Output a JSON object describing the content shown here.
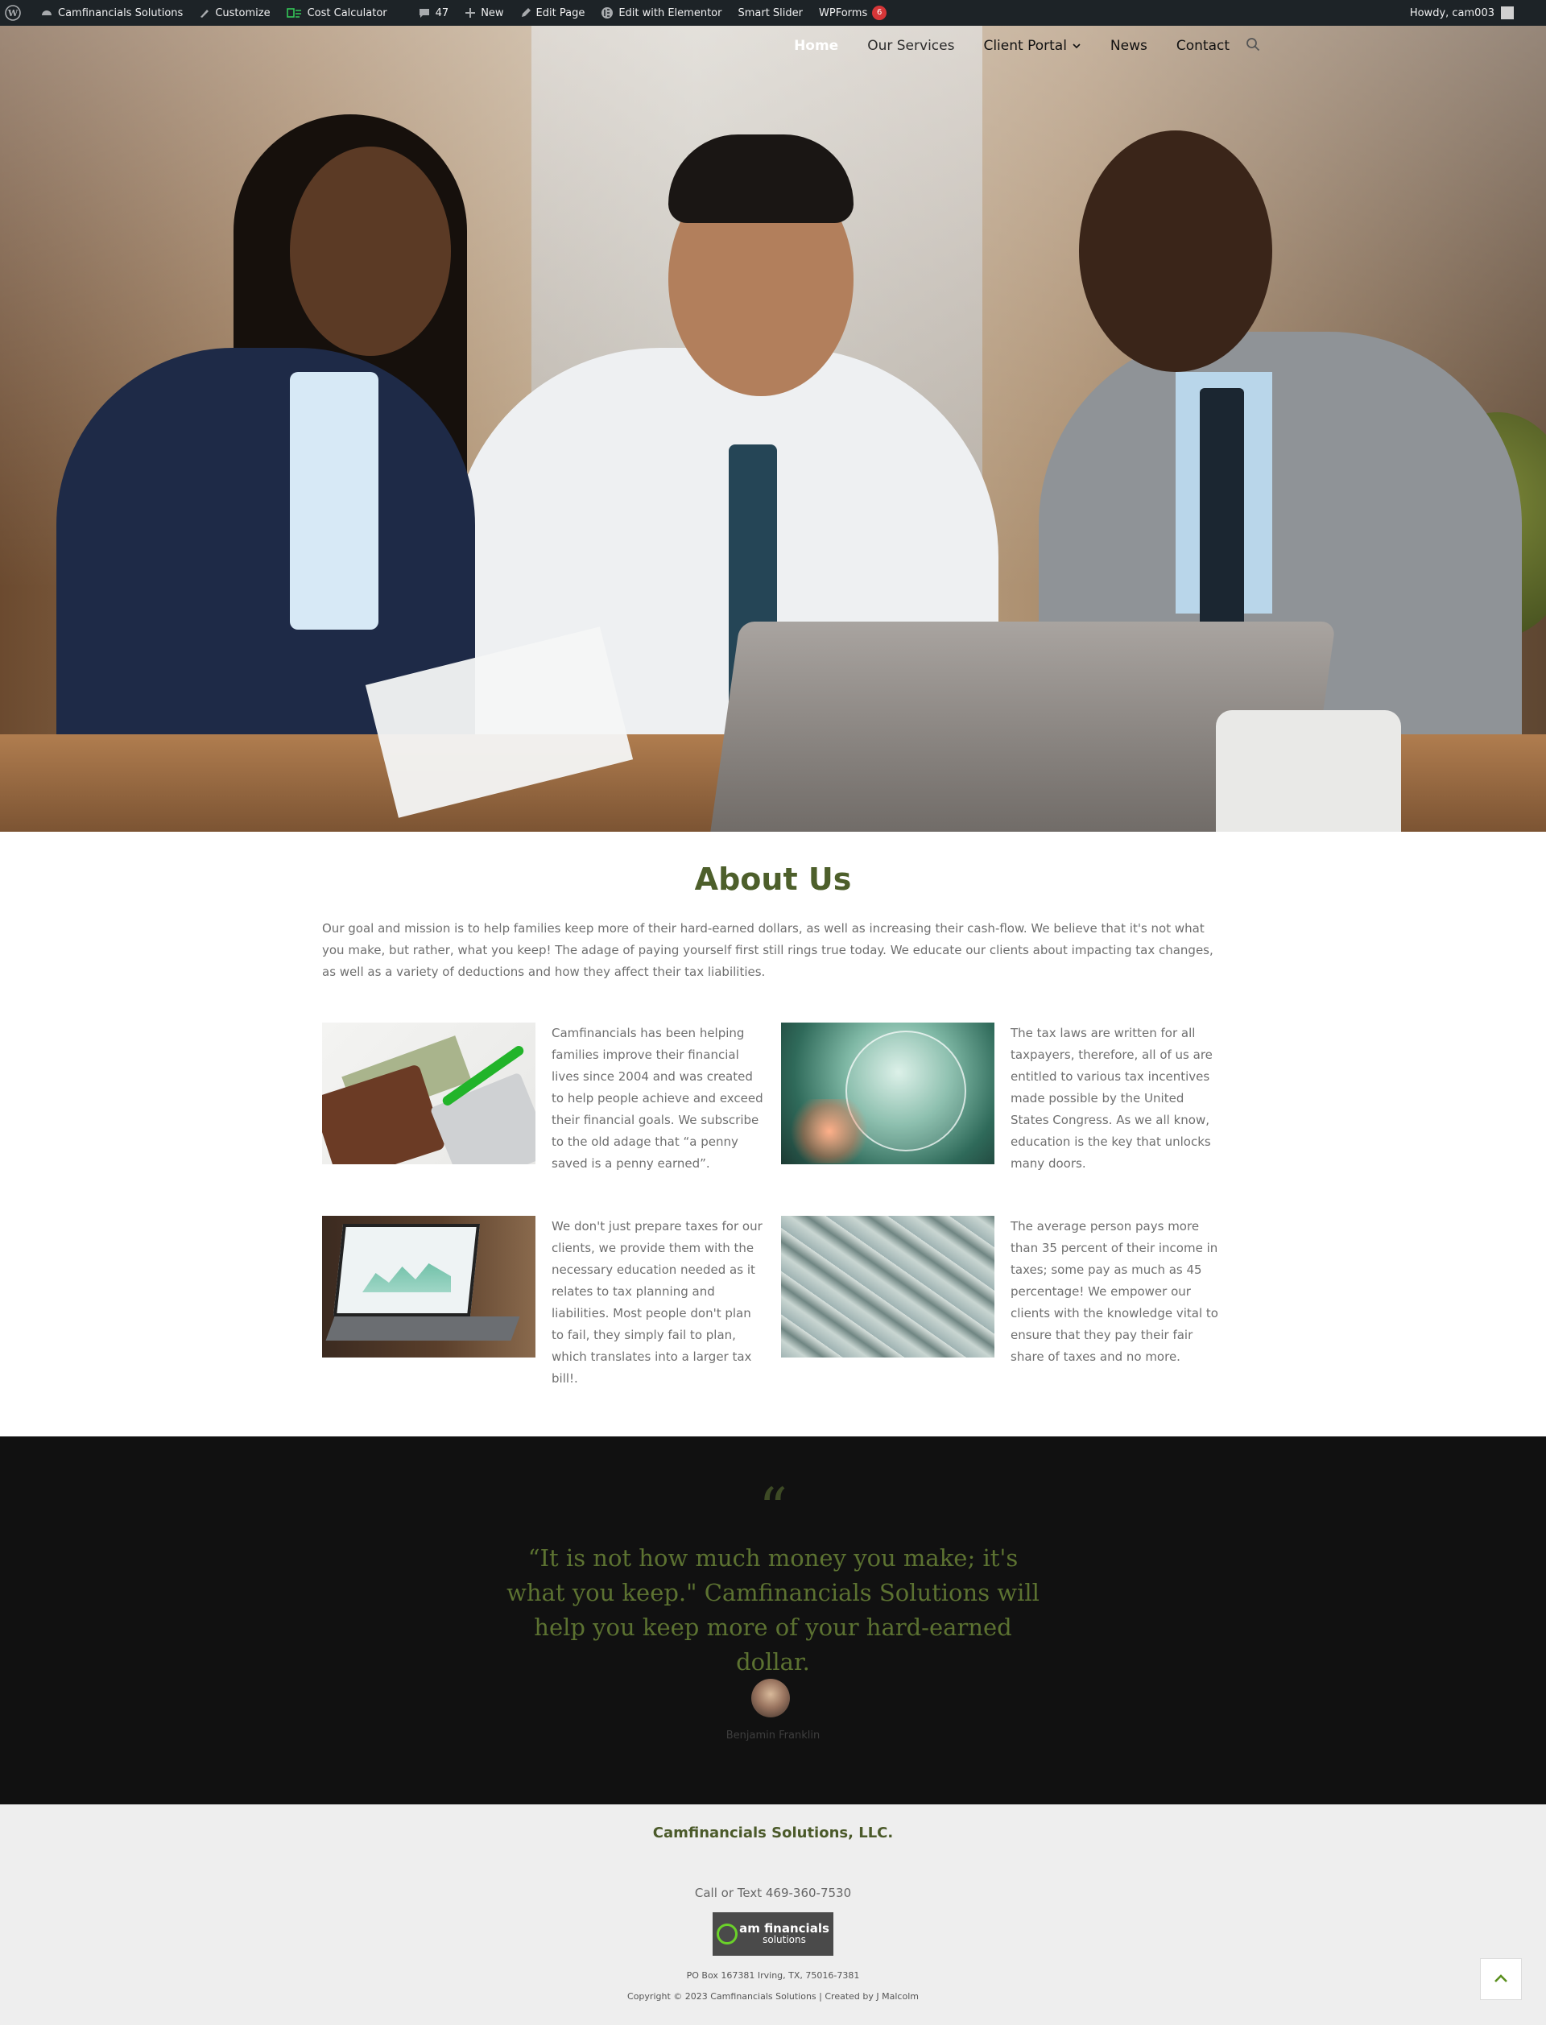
{
  "admin_bar": {
    "site_name": "Camfinancials Solutions",
    "customize": "Customize",
    "cost_calculator": "Cost Calculator",
    "comments_count": "47",
    "new": "New",
    "edit_page": "Edit Page",
    "edit_elementor": "Edit with Elementor",
    "smart_slider": "Smart Slider",
    "wpforms": "WPForms",
    "wpforms_badge": "6",
    "howdy": "Howdy, cam003"
  },
  "nav": {
    "items": [
      {
        "label": "Home"
      },
      {
        "label": "Our Services"
      },
      {
        "label": "Client Portal"
      },
      {
        "label": "News"
      },
      {
        "label": "Contact"
      }
    ]
  },
  "about": {
    "title": "About Us",
    "intro": "Our goal and mission is to help families keep more of their hard-earned dollars, as well as increasing their cash-flow. We believe that it's not what you make, but rather, what you keep! The adage of paying yourself first still rings true today. We educate our clients about impacting tax changes, as well as a variety of deductions and how they affect their tax liabilities.",
    "features": [
      {
        "text": "Camfinancials has been helping families improve their financial lives since 2004 and was created to help people achieve and exceed their financial goals. We subscribe to the old adage that “a penny saved is a penny earned”."
      },
      {
        "text": "The tax laws are written for all taxpayers, therefore, all of us are entitled to various tax incentives made possible by the United States Congress. As we all know, education is the key that unlocks many doors."
      },
      {
        "text": "We don't just prepare taxes for our clients, we provide them with the necessary education needed as it relates to tax planning and liabilities. Most people don't plan to fail, they simply fail to plan, which translates into a larger tax bill!."
      },
      {
        "text": "The average person pays more than 35 percent of their income in taxes; some pay as much as 45 percentage! We empower our clients with the knowledge vital to ensure that they pay their fair share of taxes and no more."
      }
    ]
  },
  "quote": {
    "mark": "“",
    "text": "“It is not how much money you make; it's what you keep.\" Camfinancials Solutions will help you keep more of your hard-earned dollar.",
    "author": "Benjamin Franklin"
  },
  "footer": {
    "company": "Camfinancials Solutions, LLC.",
    "phone": "Call or Text 469-360-7530",
    "logo_line1": "am financials",
    "logo_line2": "solutions",
    "address": "PO Box 167381 Irving, TX, 75016-7381",
    "copyright": "Copyright © 2023 Camfinancials Solutions | Created by J Malcolm"
  },
  "colors": {
    "accent": "#4d5f2b",
    "admin_bar": "#1d2327",
    "quote_bg": "#111111",
    "footer_bg": "#eeeeee"
  }
}
